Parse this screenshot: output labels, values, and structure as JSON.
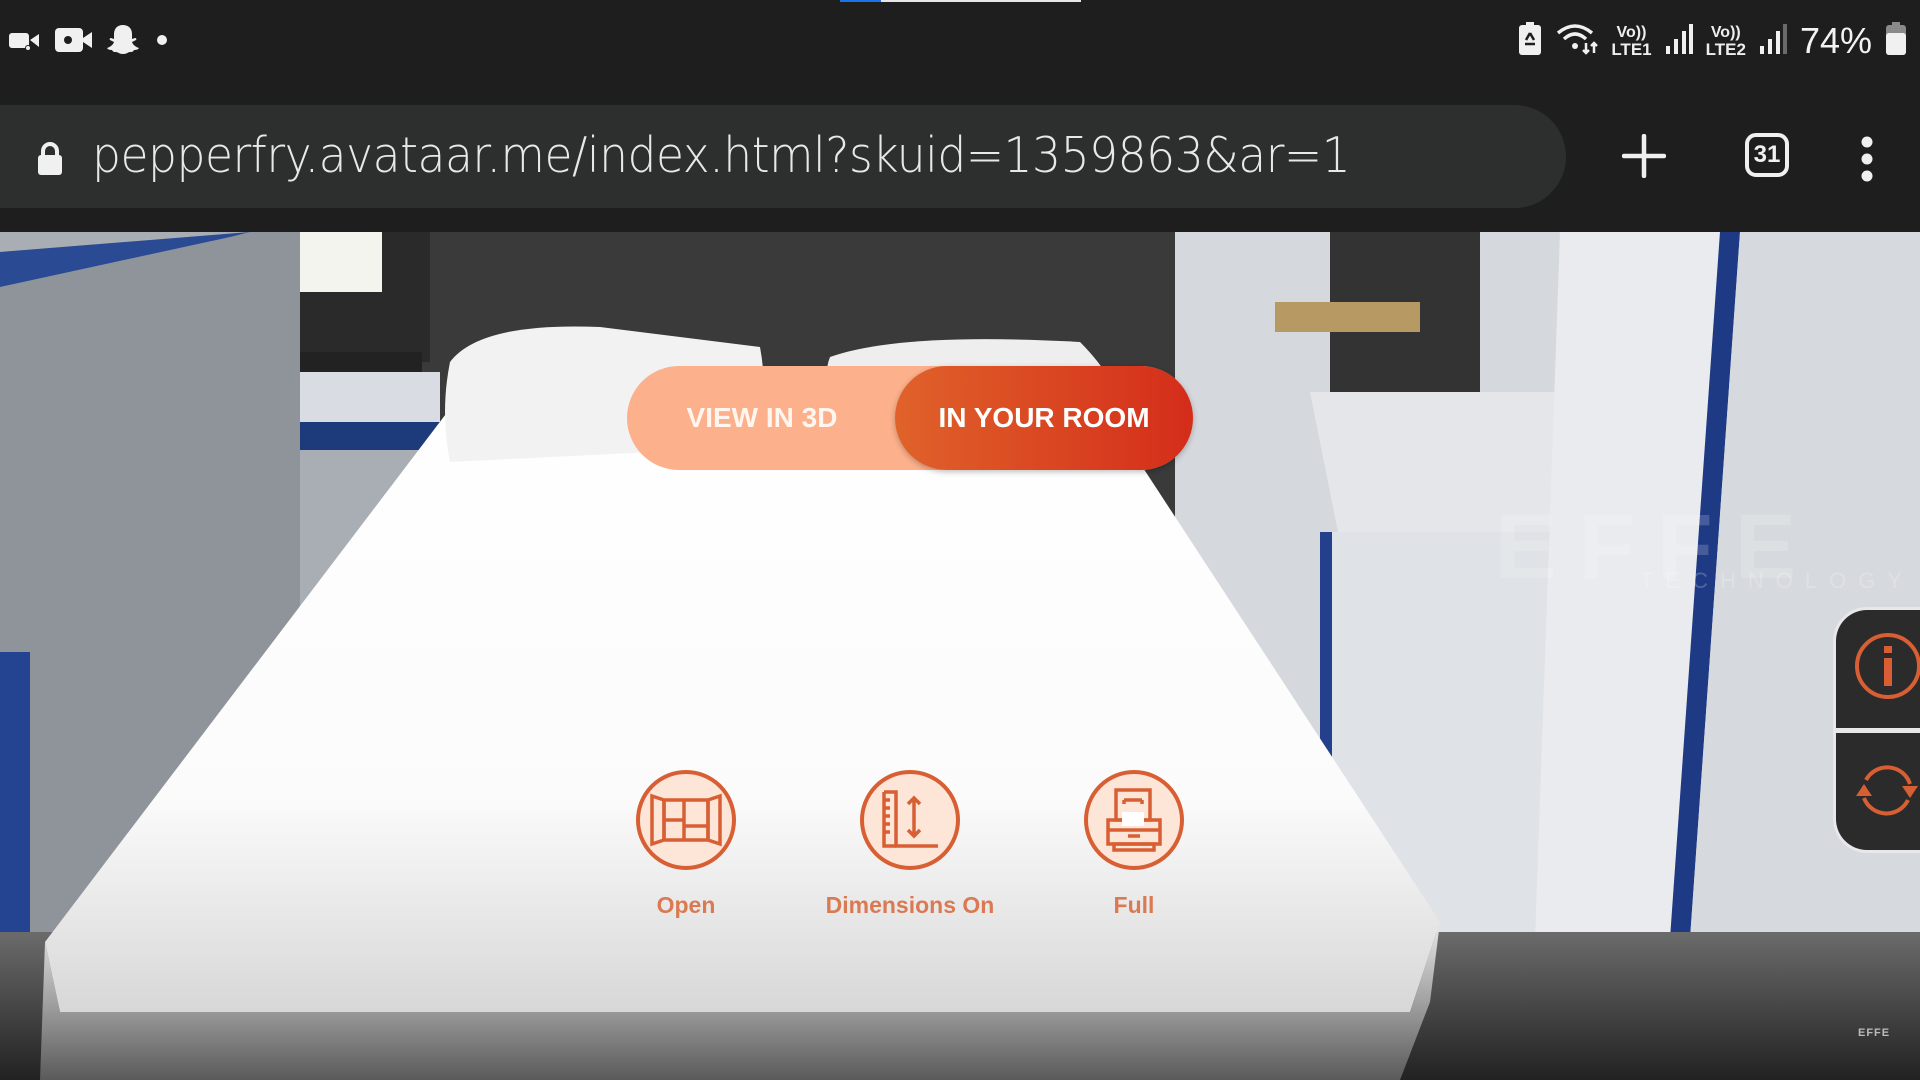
{
  "status_bar": {
    "left_icons": [
      "video-call-icon",
      "screen-record-icon",
      "snapchat-icon",
      "notification-dot-icon"
    ],
    "right_icons": [
      "battery-saver-icon",
      "wifi-icon",
      "volte-sim1-icon",
      "signal-sim1-icon",
      "volte-sim2-icon",
      "signal-sim2-icon",
      "battery-icon"
    ],
    "sim1": {
      "top": "Vo))",
      "bottom": "LTE1"
    },
    "sim2": {
      "top": "Vo))",
      "bottom": "LTE2"
    },
    "battery_percent": "74%",
    "page_load_progress": 0.17
  },
  "browser": {
    "url": "pepperfry.avataar.me/index.html?skuid=1359863&ar=1",
    "tab_count": "31",
    "new_tab_icon": "plus-icon",
    "menu_icon": "more-vert-icon",
    "secure_icon": "lock-icon"
  },
  "viewer": {
    "mode_toggle": {
      "options": [
        "VIEW IN 3D",
        "IN YOUR ROOM"
      ],
      "selected": "IN YOUR ROOM"
    },
    "tools": [
      {
        "label": "Open",
        "icon": "wardrobe-open-icon"
      },
      {
        "label": "Dimensions On",
        "icon": "ruler-dimensions-icon"
      },
      {
        "label": "Full",
        "icon": "drawer-full-icon"
      }
    ],
    "side_panel": [
      {
        "icon": "info-icon"
      },
      {
        "icon": "rotate-icon"
      }
    ],
    "watermark": {
      "brand": "EFFE",
      "tagline": "TECHNOLOGY"
    },
    "corner_logo": "EFFE",
    "colors": {
      "accent": "#d85f34",
      "toggle_inactive": "#fcb08b",
      "toggle_active_start": "#e0622a",
      "toggle_active_end": "#d42d1a",
      "tool_fill": "#fde6d8"
    }
  }
}
